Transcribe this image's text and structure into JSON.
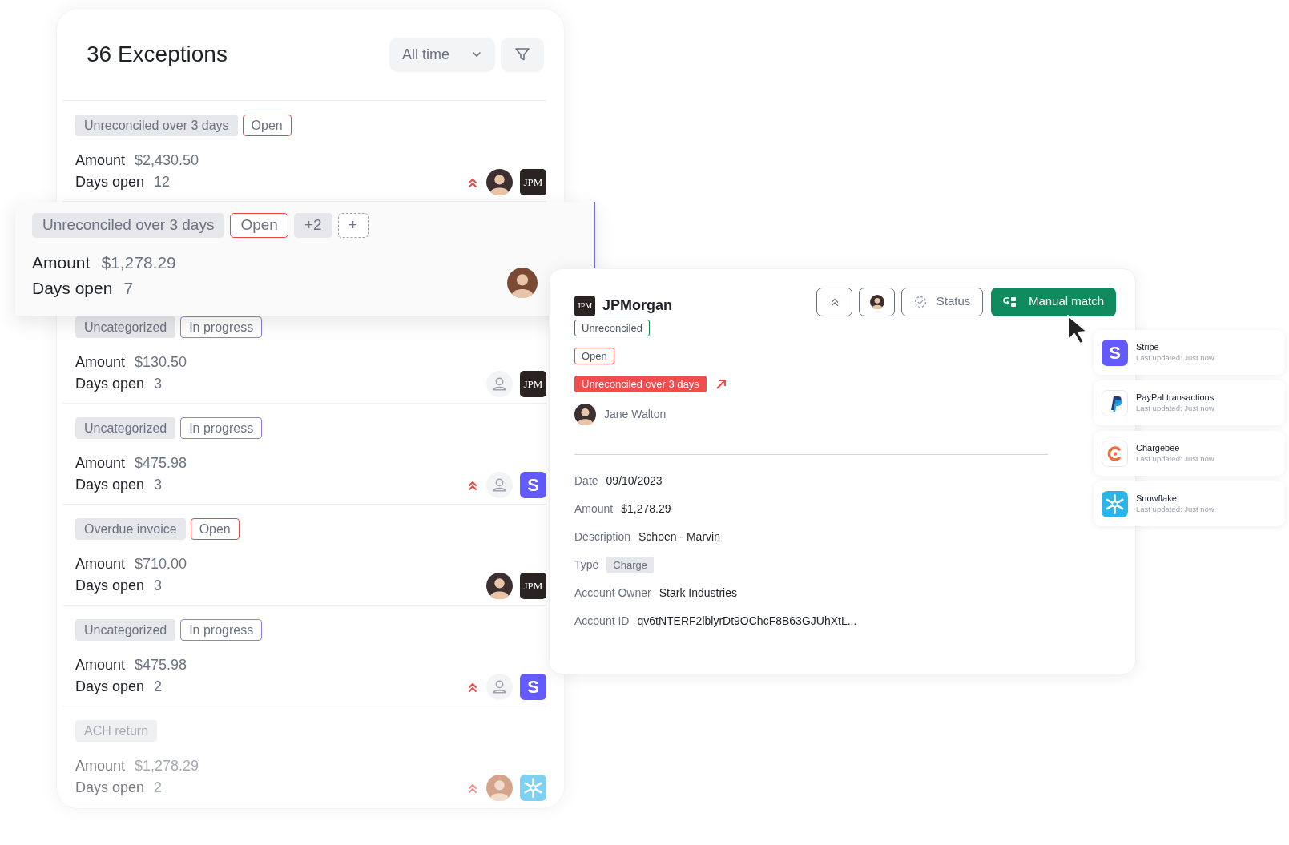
{
  "list": {
    "title": "36 Exceptions",
    "period": "All time",
    "rows": [
      {
        "raised": false,
        "faded": false,
        "tags": [
          {
            "kind": "category",
            "text": "Unreconciled over 3 days"
          },
          {
            "kind": "open",
            "text": "Open"
          }
        ],
        "amount_label": "Amount",
        "amount": "$2,430.50",
        "days_label": "Days open",
        "days": "12",
        "priority": true,
        "assigned": true,
        "source": {
          "kind": "jpm",
          "label": "JPM"
        }
      },
      {
        "raised": true,
        "faded": false,
        "tags": [
          {
            "kind": "category",
            "text": "Unreconciled over 3 days"
          },
          {
            "kind": "open",
            "text": "Open"
          },
          {
            "kind": "count",
            "text": "+2"
          },
          {
            "kind": "add",
            "text": "+"
          }
        ],
        "amount_label": "Amount",
        "amount": "$1,278.29",
        "days_label": "Days open",
        "days": "7",
        "priority": false,
        "assigned": true,
        "source": {
          "kind": "none"
        }
      },
      {
        "raised": false,
        "faded": false,
        "tags": [
          {
            "kind": "category",
            "text": "Uncategorized"
          },
          {
            "kind": "progress",
            "text": "In progress"
          }
        ],
        "amount_label": "Amount",
        "amount": "$130.50",
        "days_label": "Days open",
        "days": "3",
        "priority": false,
        "assigned": false,
        "source": {
          "kind": "jpm",
          "label": "JPM"
        }
      },
      {
        "raised": false,
        "faded": false,
        "tags": [
          {
            "kind": "category",
            "text": "Uncategorized"
          },
          {
            "kind": "progress",
            "text": "In progress"
          }
        ],
        "amount_label": "Amount",
        "amount": "$475.98",
        "days_label": "Days open",
        "days": "3",
        "priority": true,
        "assigned": false,
        "source": {
          "kind": "stripe",
          "label": "S"
        }
      },
      {
        "raised": false,
        "faded": false,
        "tags": [
          {
            "kind": "category",
            "text": "Overdue invoice"
          },
          {
            "kind": "open",
            "text": "Open"
          }
        ],
        "amount_label": "Amount",
        "amount": "$710.00",
        "days_label": "Days open",
        "days": "3",
        "priority": false,
        "assigned": true,
        "source": {
          "kind": "jpm",
          "label": "JPM"
        }
      },
      {
        "raised": false,
        "faded": false,
        "tags": [
          {
            "kind": "category",
            "text": "Uncategorized"
          },
          {
            "kind": "progress",
            "text": "In progress"
          }
        ],
        "amount_label": "Amount",
        "amount": "$475.98",
        "days_label": "Days open",
        "days": "2",
        "priority": true,
        "assigned": false,
        "source": {
          "kind": "stripe",
          "label": "S"
        }
      },
      {
        "raised": false,
        "faded": true,
        "tags": [
          {
            "kind": "category",
            "text": "ACH return"
          }
        ],
        "amount_label": "Amount",
        "amount": "$1,278.29",
        "days_label": "Days open",
        "days": "2",
        "priority": true,
        "assigned": true,
        "source": {
          "kind": "snowflake"
        }
      }
    ]
  },
  "detail": {
    "logo": "JPM",
    "title": "JPMorgan",
    "status_button": "Status",
    "match_button": "Manual match",
    "tags": [
      {
        "kind": "reconcile",
        "text": "Unreconciled"
      },
      {
        "kind": "open",
        "text": "Open"
      },
      {
        "kind": "alert",
        "text": "Unreconciled over 3 days"
      }
    ],
    "assignee": "Jane Walton",
    "fields": [
      {
        "label": "Date",
        "value": "09/10/2023"
      },
      {
        "label": "Amount",
        "value": "$1,278.29"
      },
      {
        "label": "Description",
        "value": "Schoen - Marvin"
      },
      {
        "label": "Type",
        "value": "Charge",
        "kind": "tag"
      },
      {
        "label": "Account Owner",
        "value": "Stark Industries"
      },
      {
        "label": "Account ID",
        "value": "qv6tNTERF2lblyrDt9OChcF8B63GJUhXtL..."
      }
    ]
  },
  "integrations": [
    {
      "kind": "stripe",
      "logo": "S",
      "name": "Stripe",
      "updated": "Last updated: Just now"
    },
    {
      "kind": "paypal",
      "name": "PayPal transactions",
      "updated": "Last updated: Just now"
    },
    {
      "kind": "chargebee",
      "name": "Chargebee",
      "updated": "Last updated: Just now"
    },
    {
      "kind": "snowflake",
      "name": "Snowflake",
      "updated": "Last updated: Just now"
    }
  ]
}
